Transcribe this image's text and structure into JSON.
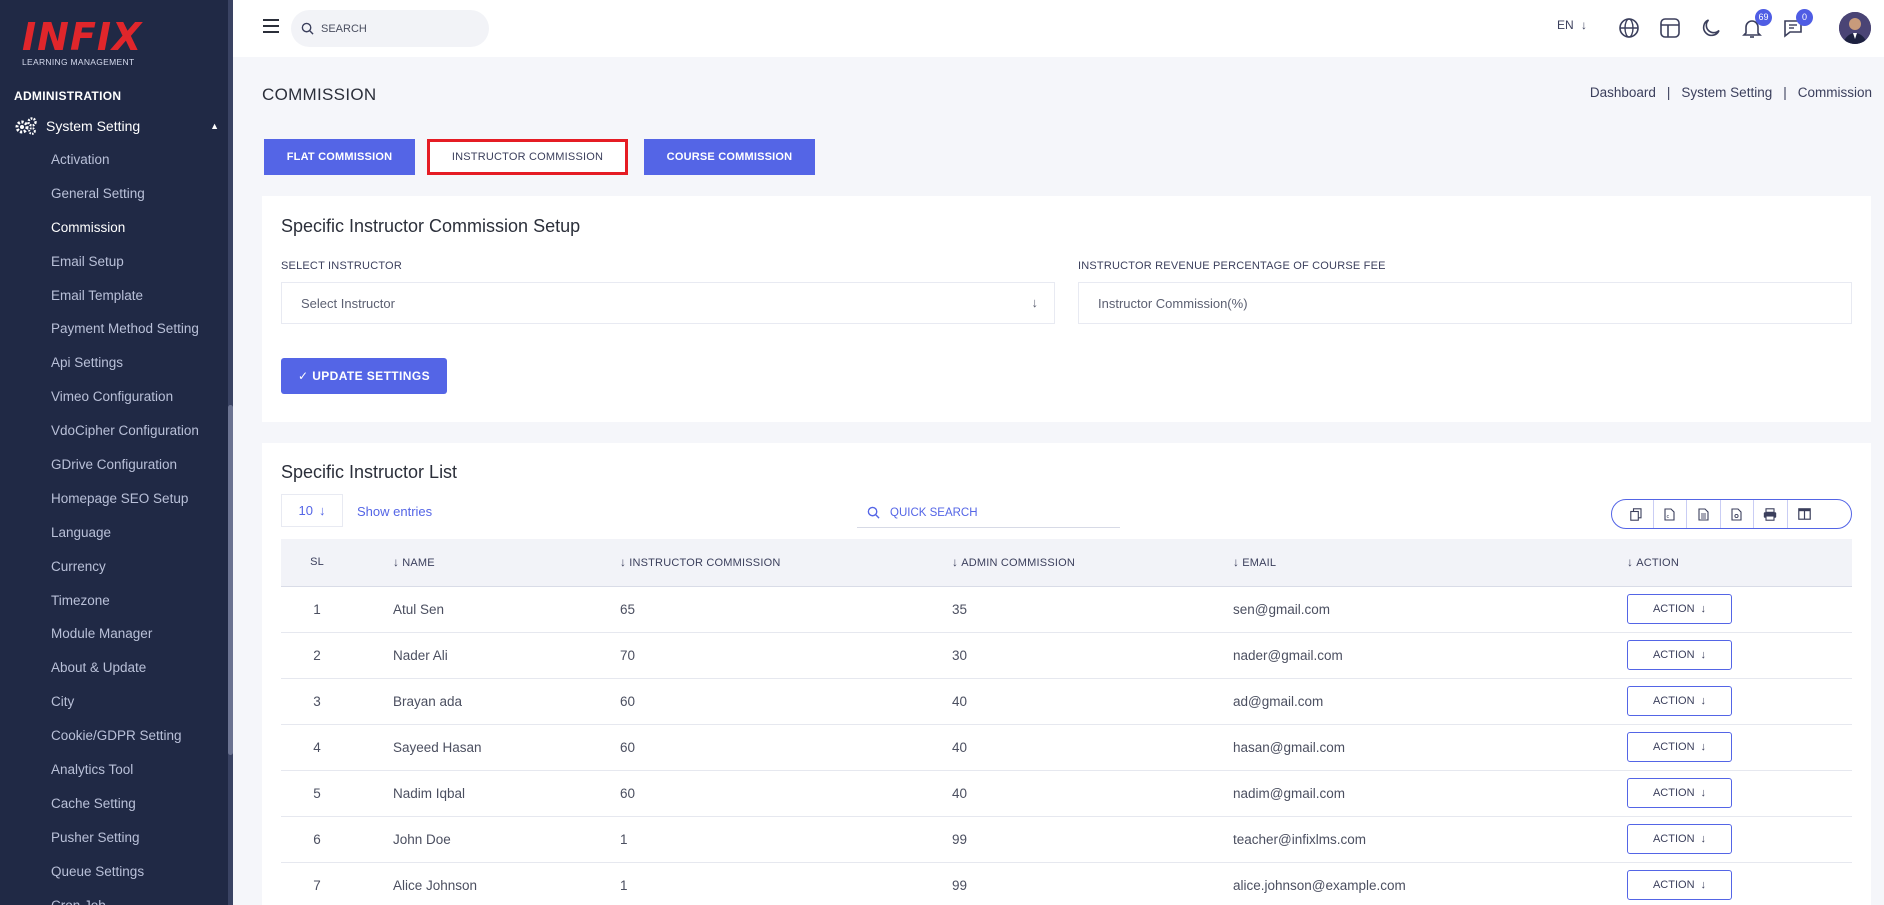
{
  "brand": {
    "logo_text": "INFIX",
    "logo_sub": "LEARNING MANAGEMENT"
  },
  "sidebar": {
    "section_title": "ADMINISTRATION",
    "group_label": "System Setting",
    "items": [
      {
        "label": "Activation",
        "active": false
      },
      {
        "label": "General Setting",
        "active": false
      },
      {
        "label": "Commission",
        "active": true
      },
      {
        "label": "Email Setup",
        "active": false
      },
      {
        "label": "Email Template",
        "active": false
      },
      {
        "label": "Payment Method Setting",
        "active": false
      },
      {
        "label": "Api Settings",
        "active": false
      },
      {
        "label": "Vimeo Configuration",
        "active": false
      },
      {
        "label": "VdoCipher Configuration",
        "active": false
      },
      {
        "label": "GDrive Configuration",
        "active": false
      },
      {
        "label": "Homepage SEO Setup",
        "active": false
      },
      {
        "label": "Language",
        "active": false
      },
      {
        "label": "Currency",
        "active": false
      },
      {
        "label": "Timezone",
        "active": false
      },
      {
        "label": "Module Manager",
        "active": false
      },
      {
        "label": "About & Update",
        "active": false
      },
      {
        "label": "City",
        "active": false
      },
      {
        "label": "Cookie/GDPR Setting",
        "active": false
      },
      {
        "label": "Analytics Tool",
        "active": false
      },
      {
        "label": "Cache Setting",
        "active": false
      },
      {
        "label": "Pusher Setting",
        "active": false
      },
      {
        "label": "Queue Settings",
        "active": false
      },
      {
        "label": "Cron Job",
        "active": false
      }
    ]
  },
  "topbar": {
    "search_placeholder": "SEARCH",
    "language": "EN",
    "notification_count": "69",
    "message_count": "0"
  },
  "page": {
    "title": "COMMISSION",
    "breadcrumb": [
      "Dashboard",
      "System Setting",
      "Commission"
    ],
    "breadcrumb_sep": "|"
  },
  "tabs": [
    {
      "label": "FLAT COMMISSION",
      "selected": false
    },
    {
      "label": "INSTRUCTOR COMMISSION",
      "selected": true
    },
    {
      "label": "COURSE COMMISSION",
      "selected": false
    }
  ],
  "setup": {
    "title": "Specific Instructor Commission Setup",
    "select_label": "SELECT INSTRUCTOR",
    "select_value": "Select Instructor",
    "percent_label": "INSTRUCTOR REVENUE PERCENTAGE OF COURSE FEE",
    "percent_placeholder": "Instructor Commission(%)",
    "update_button": "✓ UPDATE SETTINGS"
  },
  "list": {
    "title": "Specific Instructor List",
    "entries_value": "10",
    "entries_label": "Show entries",
    "quick_search_placeholder": "QUICK SEARCH",
    "export_icons": [
      "copy-icon",
      "csv-icon",
      "excel-icon",
      "pdf-icon",
      "print-icon",
      "columns-icon"
    ],
    "columns": [
      "SL",
      "NAME",
      "INSTRUCTOR COMMISSION",
      "ADMIN COMMISSION",
      "EMAIL",
      "ACTION"
    ],
    "action_label": "ACTION",
    "rows": [
      {
        "sl": "1",
        "name": "Atul Sen",
        "instructor_commission": "65",
        "admin_commission": "35",
        "email": "sen@gmail.com"
      },
      {
        "sl": "2",
        "name": "Nader Ali",
        "instructor_commission": "70",
        "admin_commission": "30",
        "email": "nader@gmail.com"
      },
      {
        "sl": "3",
        "name": "Brayan ada",
        "instructor_commission": "60",
        "admin_commission": "40",
        "email": "ad@gmail.com"
      },
      {
        "sl": "4",
        "name": "Sayeed Hasan",
        "instructor_commission": "60",
        "admin_commission": "40",
        "email": "hasan@gmail.com"
      },
      {
        "sl": "5",
        "name": "Nadim Iqbal",
        "instructor_commission": "60",
        "admin_commission": "40",
        "email": "nadim@gmail.com"
      },
      {
        "sl": "6",
        "name": "John Doe",
        "instructor_commission": "1",
        "admin_commission": "99",
        "email": "teacher@infixlms.com"
      },
      {
        "sl": "7",
        "name": "Alice Johnson",
        "instructor_commission": "1",
        "admin_commission": "99",
        "email": "alice.johnson@example.com"
      }
    ]
  },
  "colors": {
    "primary": "#5465e6",
    "sidebar_bg": "#202945",
    "highlight": "#e51c24"
  }
}
